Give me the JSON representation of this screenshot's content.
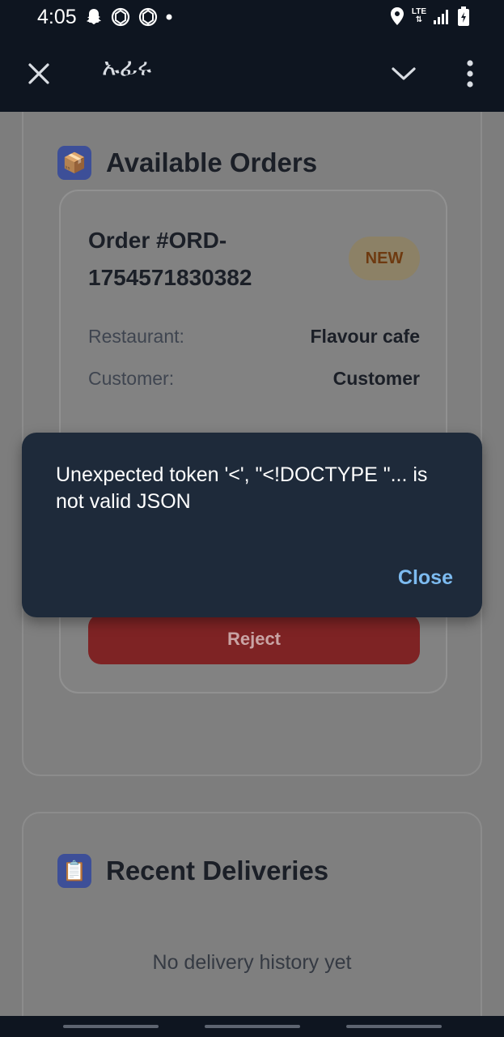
{
  "status_bar": {
    "time": "4:05",
    "network": "LTE",
    "left_icons": [
      "snapchat-icon",
      "chatgpt-icon",
      "chatgpt-icon",
      "dot-icon"
    ],
    "right_icons": [
      "location-icon",
      "lte-signal-icon",
      "signal-bars-icon",
      "battery-icon"
    ]
  },
  "toolbar": {
    "title": "ኡፊሩ",
    "icons": [
      "close-icon",
      "chevron-down-icon",
      "more-vert-icon"
    ]
  },
  "orders_section": {
    "icon": "package-icon",
    "title": "Available Orders",
    "order": {
      "title": "Order #ORD-1754571830382",
      "badge": "NEW",
      "restaurant_label": "Restaurant:",
      "restaurant_value": "Flavour cafe",
      "customer_label": "Customer:",
      "customer_value": "Customer",
      "reject_label": "Reject"
    }
  },
  "recent_section": {
    "icon": "clipboard-icon",
    "title": "Recent Deliveries",
    "empty_text": "No delivery history yet"
  },
  "snackbar": {
    "message": "Unexpected token '<', \"<!DOCTYPE \"... is not valid JSON",
    "action_label": "Close"
  },
  "colors": {
    "status_bar_bg": "#0e1520",
    "snackbar_bg": "#1e2a3a",
    "snackbar_action": "#7dbbf0",
    "reject_bg": "#7e2324",
    "accept_bg": "#1f6b34",
    "badge_bg": "#8c8166"
  }
}
